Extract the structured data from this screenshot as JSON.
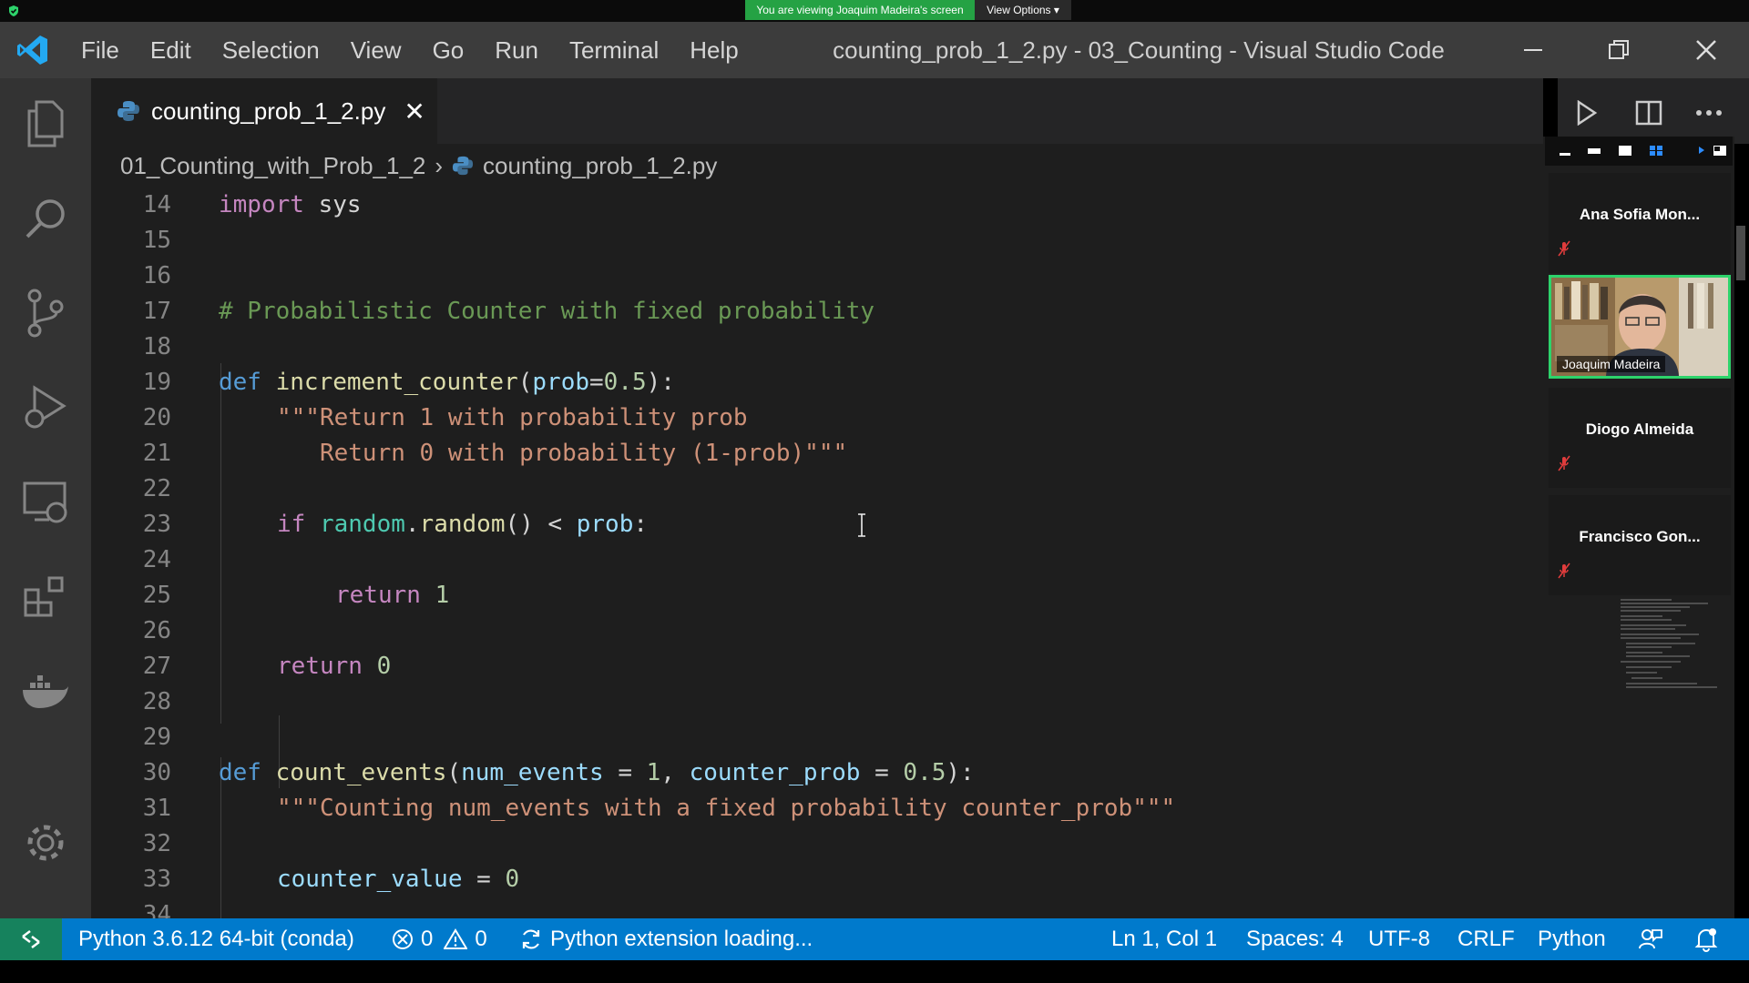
{
  "share": {
    "message": "You are viewing Joaquim Madeira's screen",
    "view_options": "View Options",
    "banner_color": "#25a244"
  },
  "titlebar": {
    "menu": [
      "File",
      "Edit",
      "Selection",
      "View",
      "Go",
      "Run",
      "Terminal",
      "Help"
    ],
    "title": "counting_prob_1_2.py - 03_Counting - Visual Studio Code"
  },
  "tab": {
    "label": "counting_prob_1_2.py",
    "close": "✕"
  },
  "breadcrumb": {
    "folder": "01_Counting_with_Prob_1_2",
    "sep": "›",
    "file": "counting_prob_1_2.py"
  },
  "editor": {
    "line_numbers": [
      "14",
      "15",
      "16",
      "17",
      "18",
      "19",
      "20",
      "21",
      "22",
      "23",
      "24",
      "25",
      "26",
      "27",
      "28",
      "29",
      "30",
      "31",
      "32",
      "33",
      "34"
    ],
    "lines": {
      "l14_kw": "import",
      "l14_rest": " sys",
      "l17_comment": "# Probabilistic Counter with fixed probability",
      "l19_def": "def",
      "l19_fn": "increment_counter",
      "l19_open": "(",
      "l19_param": "prob",
      "l19_eq": "=",
      "l19_num": "0.5",
      "l19_close": "):",
      "l20_str": "\"\"\"Return 1 with probability prob",
      "l21_str": "   Return 0 with probability (1-prob)\"\"\"",
      "l23_if": "if",
      "l23_mod": "random",
      "l23_dot": ".",
      "l23_fn": "random",
      "l23_rest": "() < ",
      "l23_param": "prob",
      "l23_colon": ":",
      "l25_ret": "return",
      "l25_num": "1",
      "l27_ret": "return",
      "l27_num": "0",
      "l30_def": "def",
      "l30_fn": "count_events",
      "l30_open": "(",
      "l30_p1": "num_events",
      "l30_eq1": " = ",
      "l30_n1": "1",
      "l30_comma": ", ",
      "l30_p2": "counter_prob",
      "l30_eq2": " = ",
      "l30_n2": "0.5",
      "l30_close": "):",
      "l31_str": "\"\"\"Counting num_events with a fixed probability counter_prob\"\"\"",
      "l33_var": "counter_value",
      "l33_eq": " = ",
      "l33_num": "0"
    }
  },
  "gallery": {
    "participants": [
      "Ana Sofia Mon...",
      "Diogo Almeida",
      "Francisco Gon..."
    ],
    "video_name": "Joaquim Madeira",
    "active_border": "#2dd36b"
  },
  "statusbar": {
    "interpreter": "Python 3.6.12 64-bit (conda)",
    "errors": "0",
    "warnings": "0",
    "extension": "Python extension loading...",
    "position": "Ln 1, Col 1",
    "spaces": "Spaces: 4",
    "encoding": "UTF-8",
    "eol": "CRLF",
    "language": "Python",
    "color": "#007acc"
  }
}
